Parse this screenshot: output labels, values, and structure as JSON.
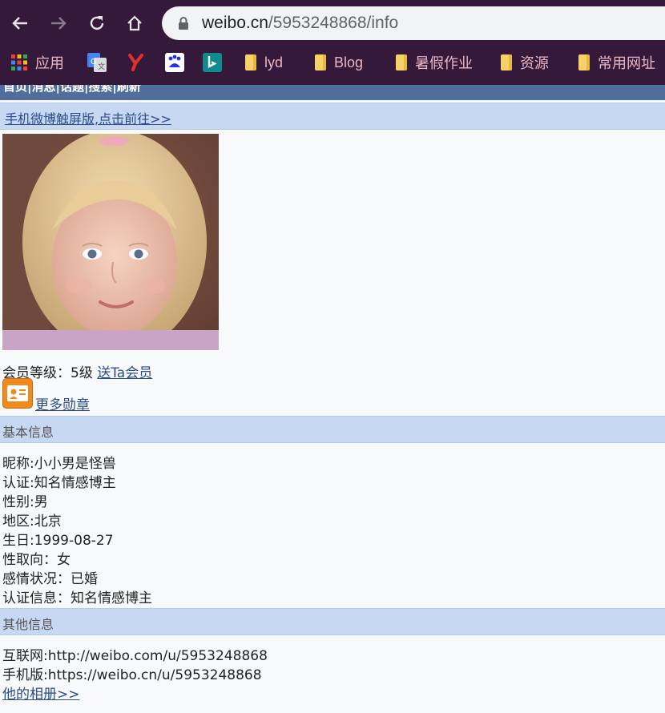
{
  "browser": {
    "url_host": "weibo.cn",
    "url_path": "/5953248868/info",
    "bookmarks": [
      {
        "label": "应用",
        "icon": "apps-grid-icon"
      },
      {
        "label": "",
        "icon": "google-translate-icon"
      },
      {
        "label": "",
        "icon": "y-logo-icon"
      },
      {
        "label": "",
        "icon": "baidu-icon"
      },
      {
        "label": "",
        "icon": "bing-icon"
      },
      {
        "label": "lyd",
        "icon": "folder-icon"
      },
      {
        "label": "Blog",
        "icon": "folder-icon"
      },
      {
        "label": "暑假作业",
        "icon": "folder-icon"
      },
      {
        "label": "资源",
        "icon": "folder-icon"
      },
      {
        "label": "常用网址",
        "icon": "folder-icon"
      }
    ]
  },
  "page": {
    "top_nav": "首页|消息|话题|搜索|刷新",
    "promo_link": "手机微博触屏版,点击前往>>",
    "member": {
      "label": "会员等级：5级",
      "gift_link": "送Ta会员"
    },
    "more_badges": "更多勋章",
    "basic_info": {
      "heading": "基本信息",
      "lines": [
        "昵称:小小男是怪兽",
        "认证:知名情感博主",
        "性别:男",
        "地区:北京",
        "生日:1999-08-27",
        "性取向：女",
        "感情状况：已婚",
        "认证信息：知名情感博主"
      ]
    },
    "other_info": {
      "heading": "其他信息",
      "internet": "互联网:http://weibo.com/u/5953248868",
      "mobile": "手机版:https://weibo.cn/u/5953248868",
      "album_link": "他的相册>>"
    }
  }
}
